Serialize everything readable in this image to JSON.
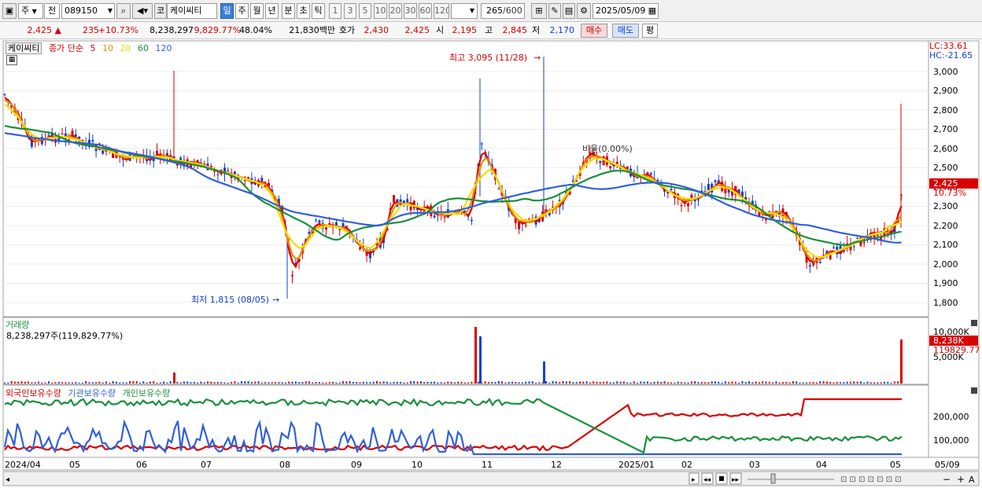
{
  "toolbar": {
    "market": "주",
    "type": "전",
    "code": "089150",
    "name": "케이씨티",
    "coin": "코",
    "periods": [
      "일",
      "주",
      "월",
      "년",
      "분",
      "초",
      "틱"
    ],
    "active_period": "일",
    "intervals": [
      "1",
      "3",
      "5",
      "10",
      "20",
      "30",
      "60",
      "120"
    ],
    "count": "265",
    "count_total": "/600",
    "date": "2025/05/09"
  },
  "quote": {
    "price": "2,425",
    "change": "235",
    "change_pct": "+10.73%",
    "volume": "8,238,297",
    "volume_ratio": "9,829.77%",
    "turnover": "48.04%",
    "amount": "21,830백만",
    "ask_label": "호가",
    "ask": "2,430",
    "bid": "2,425",
    "open_label": "시",
    "open": "2,195",
    "high_label": "고",
    "high": "2,845",
    "low_label": "저",
    "low": "2,170",
    "buy": "매수",
    "sell": "매도",
    "eval": "평"
  },
  "price_panel": {
    "stock": "케이씨티",
    "ma_label": "종가 단순",
    "ma": [
      {
        "period": "5",
        "color": "#d80000"
      },
      {
        "period": "10",
        "color": "#f08c00"
      },
      {
        "period": "20",
        "color": "#f0e000"
      },
      {
        "period": "60",
        "color": "#1a8f3a"
      },
      {
        "period": "120",
        "color": "#3060d8"
      }
    ],
    "lc": "LC:33.61",
    "hc": "HC:-21.65",
    "annot_high": "최고 3,095 (11/28)",
    "annot_low": "최저 1,815 (08/05)",
    "annot_mid": "비율(0.00%)",
    "last_price": "2,425",
    "last_pct": "10.73%",
    "y_ticks": [
      "3,000",
      "2,900",
      "2,800",
      "2,700",
      "2,600",
      "2,500",
      "2,400",
      "2,300",
      "2,200",
      "2,100",
      "2,000",
      "1,900",
      "1,800"
    ]
  },
  "volume_panel": {
    "title": "거래량",
    "value": "8,238,297주(119,829.77%)",
    "y_ticks": [
      "10,000K",
      "5,000K"
    ],
    "last_value": "8,238K",
    "last_ratio": "119829.77"
  },
  "holdings_panel": {
    "series": [
      "외국인보유수량",
      "기관보유수량",
      "개인보유수량"
    ],
    "y_ticks": [
      "200,000",
      "100,000"
    ]
  },
  "x_axis": [
    "2024/04",
    "05",
    "06",
    "07",
    "08",
    "09",
    "10",
    "11",
    "12",
    "2025/01",
    "02",
    "03",
    "04",
    "05",
    "05/09"
  ],
  "colors": {
    "up": "#d80000",
    "down": "#1040d0",
    "foreign": "#d80000",
    "institution": "#3060d8",
    "individual": "#1a8f3a"
  }
}
